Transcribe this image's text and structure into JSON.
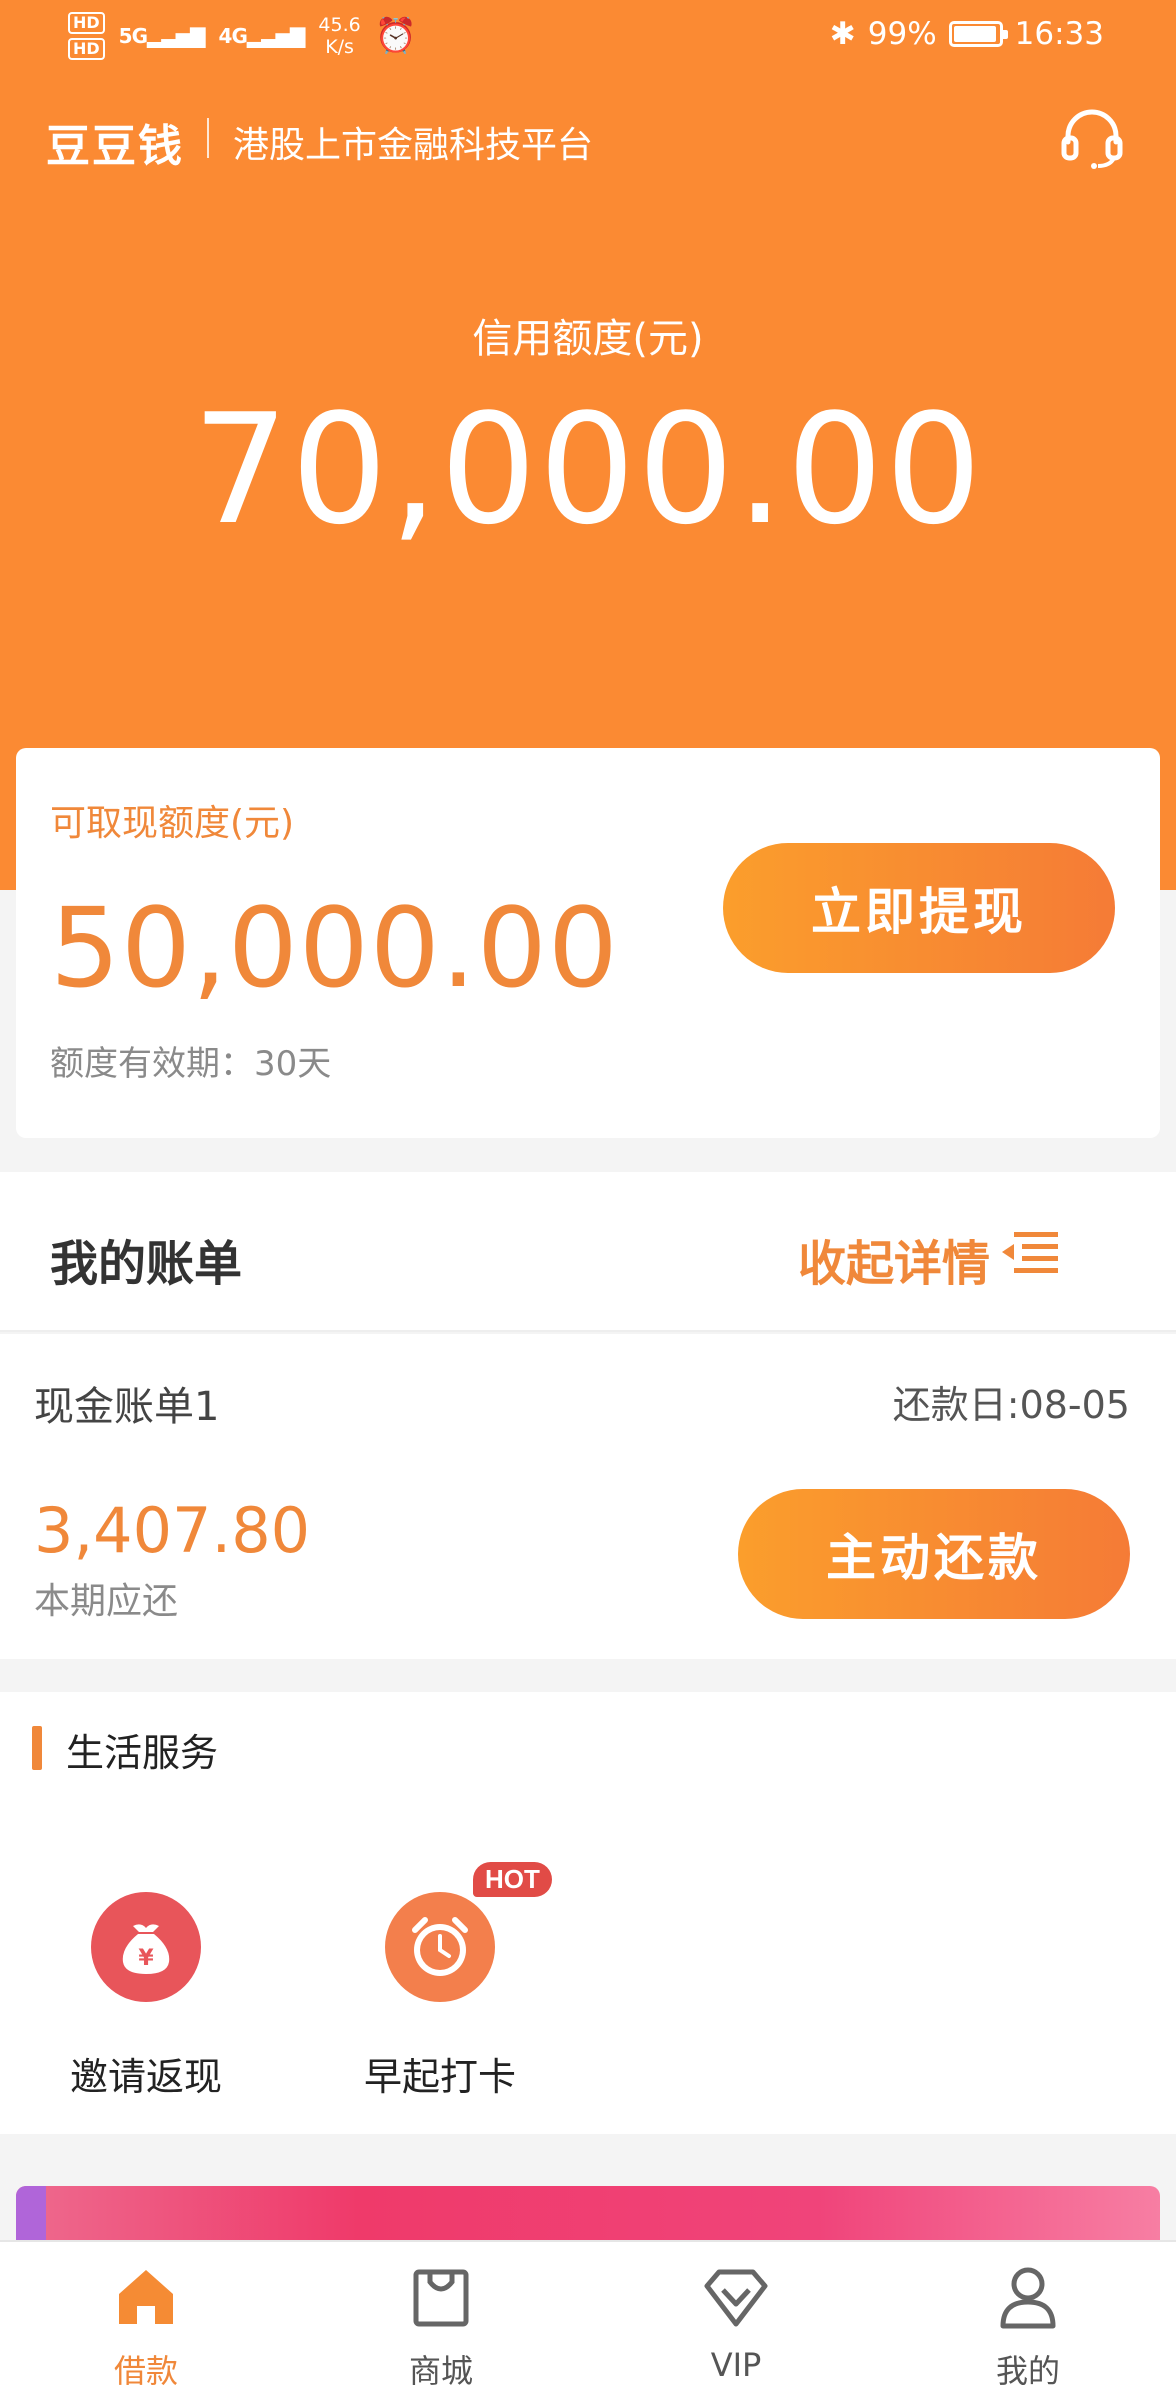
{
  "status_bar": {
    "hd1": "HD",
    "hd2": "HD",
    "signal1": "5G",
    "signal2": "4G",
    "net_speed_value": "45.6",
    "net_speed_unit": "K/s",
    "bluetooth": "✱",
    "battery_percent": "99%",
    "battery_level": 0.99,
    "time": "16:33"
  },
  "header": {
    "logo": "豆豆钱",
    "slogan": "港股上市金融科技平台",
    "support_icon": "headset-icon"
  },
  "credit": {
    "label": "信用额度(元)",
    "amount": "70,000.00"
  },
  "withdraw_card": {
    "label": "可取现额度(元)",
    "amount": "50,000.00",
    "validity": "额度有效期：30天",
    "button": "立即提现"
  },
  "bills": {
    "title": "我的账单",
    "collapse": "收起详情",
    "items": [
      {
        "name": "现金账单1",
        "due": "还款日:08-05",
        "amount": "3,407.80",
        "sub": "本期应还",
        "button": "主动还款"
      }
    ]
  },
  "services": {
    "title": "生活服务",
    "items": [
      {
        "label": "邀请返现",
        "icon": "money-bag-icon"
      },
      {
        "label": "早起打卡",
        "icon": "alarm-clock-icon",
        "badge": "HOT"
      }
    ]
  },
  "tabs": [
    {
      "label": "借款",
      "icon": "home-icon",
      "active": true
    },
    {
      "label": "商城",
      "icon": "shopping-bag-icon"
    },
    {
      "label": "VIP",
      "icon": "diamond-icon"
    },
    {
      "label": "我的",
      "icon": "user-icon"
    }
  ],
  "colors": {
    "brand_orange": "#fb8a33",
    "accent_text": "#f0883a",
    "hot_red": "#e14b46"
  }
}
